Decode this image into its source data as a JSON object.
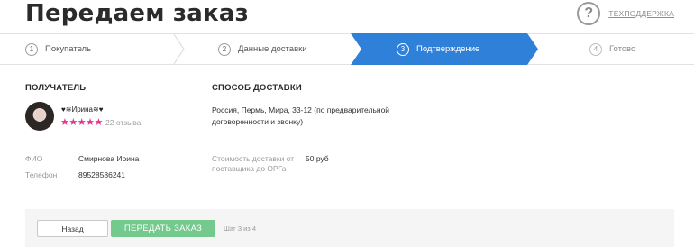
{
  "header": {
    "title": "Передаем заказ",
    "support_icon": "question-mark-icon",
    "support_label": "ТЕХПОДДЕРЖКА"
  },
  "steps": [
    {
      "num": "1",
      "label": "Покупатель"
    },
    {
      "num": "2",
      "label": "Данные доставки"
    },
    {
      "num": "3",
      "label": "Подтверждение"
    },
    {
      "num": "4",
      "label": "Готово"
    }
  ],
  "colors": {
    "active_step": "#2f80d9",
    "submit": "#74c98d",
    "stars": "#e8338d"
  },
  "recipient": {
    "heading": "ПОЛУЧАТЕЛЬ",
    "nickname": "♥≋Ирина≋♥",
    "stars": "★★★★★",
    "reviews": "22 отзыва",
    "fio_label": "ФИО",
    "fio_value": "Смирнова Ирина",
    "phone_label": "Телефон",
    "phone_value": "89528586241"
  },
  "delivery": {
    "heading": "СПОСОБ ДОСТАВКИ",
    "address": "Россия, Пермь, Мира, 33-12 (по предварительной договоренности и звонку)",
    "cost_label": "Стоимость доставки от поставщика до ОРГа",
    "cost_value": "50 руб"
  },
  "footer": {
    "back_label": "Назад",
    "submit_label": "ПЕРЕДАТЬ ЗАКАЗ",
    "step_info": "Шаг 3 из 4"
  }
}
